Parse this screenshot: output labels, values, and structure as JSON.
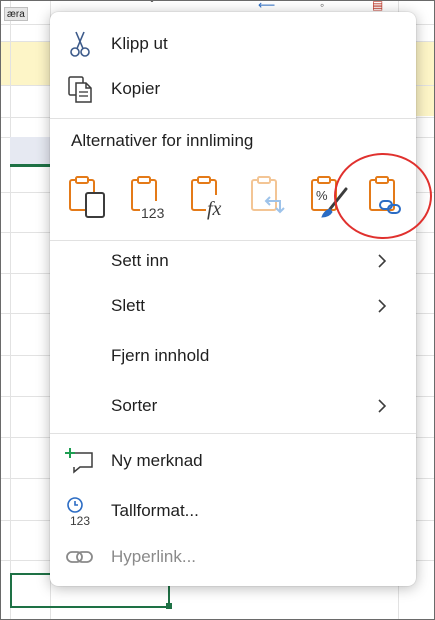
{
  "sheet": {
    "tab_label": "æra"
  },
  "menu": {
    "items": [
      {
        "label": "Klipp ut",
        "icon": "scissors-icon"
      },
      {
        "label": "Kopier",
        "icon": "copy-icon"
      }
    ],
    "paste_heading": "Alternativer for innliming",
    "paste_options": [
      {
        "icon": "paste-keep-formatting-icon",
        "sub": ""
      },
      {
        "icon": "paste-values-icon",
        "sub": "123"
      },
      {
        "icon": "paste-formulas-icon",
        "sub": "fx"
      },
      {
        "icon": "paste-transpose-icon",
        "sub": ""
      },
      {
        "icon": "paste-formatting-icon",
        "sub": "%"
      },
      {
        "icon": "paste-link-icon",
        "sub": ""
      }
    ],
    "secondary": [
      {
        "label": "Sett inn",
        "has_submenu": true
      },
      {
        "label": "Slett",
        "has_submenu": true
      },
      {
        "label": "Fjern innhold",
        "has_submenu": false
      },
      {
        "label": "Sorter",
        "has_submenu": true
      }
    ],
    "bottom": [
      {
        "label": "Ny merknad",
        "icon": "new-comment-icon",
        "disabled": false
      },
      {
        "label": "Tallformat...",
        "icon": "number-format-icon",
        "disabled": false
      },
      {
        "label": "Hyperlink...",
        "icon": "hyperlink-icon",
        "disabled": true
      }
    ]
  },
  "colors": {
    "accent_orange": "#e47a18",
    "green_accent": "#1e7145",
    "highlight_red": "#e0312e",
    "disabled_gray": "#8a8a8a"
  }
}
